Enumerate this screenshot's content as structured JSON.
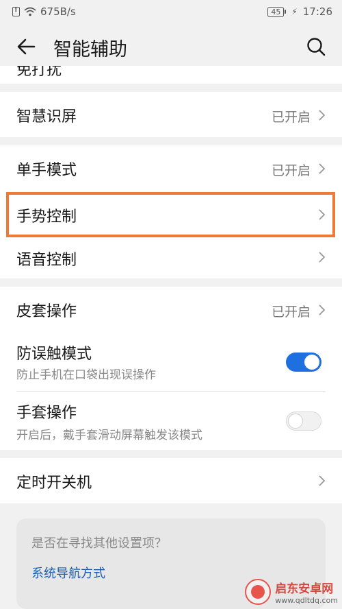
{
  "status": {
    "speed": "675B/s",
    "battery": "45",
    "time": "17:26"
  },
  "header": {
    "title": "智能辅助"
  },
  "partial_row": {
    "label": "免打扰"
  },
  "rows": {
    "smart_screen": {
      "label": "智慧识屏",
      "value": "已开启"
    },
    "one_hand": {
      "label": "单手模式",
      "value": "已开启"
    },
    "gesture": {
      "label": "手势控制"
    },
    "voice": {
      "label": "语音控制"
    },
    "cover": {
      "label": "皮套操作",
      "value": "已开启"
    },
    "anti_touch": {
      "label": "防误触模式",
      "sub": "防止手机在口袋出现误操作",
      "on": true
    },
    "glove": {
      "label": "手套操作",
      "sub": "开启后，戴手套滑动屏幕触发该模式",
      "on": false
    },
    "timer_power": {
      "label": "定时开关机"
    }
  },
  "suggest": {
    "question": "是否在寻找其他设置项？",
    "link": "系统导航方式"
  },
  "watermark": {
    "title": "启东安卓网",
    "url": "www.qdltdq.com"
  },
  "colors": {
    "accent": "#1e6fe0",
    "highlight": "#f07a35",
    "link": "#1a5fb4"
  }
}
